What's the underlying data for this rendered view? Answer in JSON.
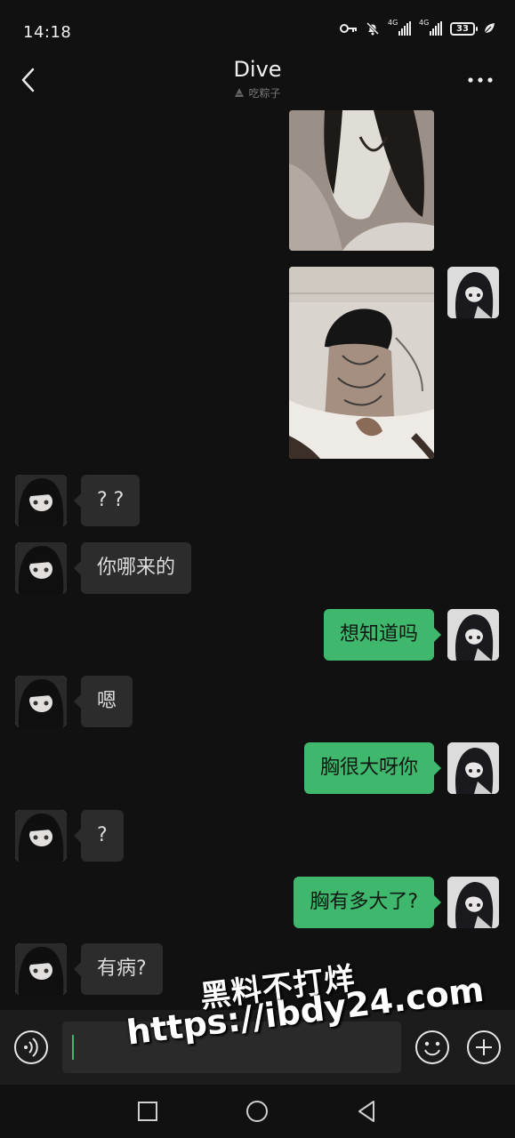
{
  "status_bar": {
    "time": "14:18",
    "network_label_1": "4G",
    "network_label_2": "4G",
    "battery": "33",
    "icons": [
      "key-icon",
      "bell-off-icon",
      "signal-icon",
      "signal-icon",
      "battery-icon",
      "leaf-icon"
    ]
  },
  "header": {
    "title": "Dive",
    "subtitle": "吃粽子",
    "back_icon": "chevron-left-icon",
    "more_icon": "more-horizontal-icon"
  },
  "messages": [
    {
      "side": "right",
      "type": "image",
      "icon": "photo-icon"
    },
    {
      "side": "right",
      "type": "image",
      "icon": "photo-icon"
    },
    {
      "side": "left",
      "type": "text",
      "text": "? ?"
    },
    {
      "side": "left",
      "type": "text",
      "text": "你哪来的"
    },
    {
      "side": "right",
      "type": "text",
      "text": "想知道吗"
    },
    {
      "side": "left",
      "type": "text",
      "text": "嗯"
    },
    {
      "side": "right",
      "type": "text",
      "text": "胸很大呀你"
    },
    {
      "side": "left",
      "type": "text",
      "text": "?"
    },
    {
      "side": "right",
      "type": "text",
      "text": "胸有多大了?"
    },
    {
      "side": "left",
      "type": "text",
      "text": "有病?"
    }
  ],
  "input_bar": {
    "voice_icon": "voice-icon",
    "emoji_icon": "emoji-icon",
    "plus_icon": "plus-icon",
    "text": ""
  },
  "nav_bar": {
    "icons": [
      "recent-apps-icon",
      "home-icon",
      "back-triangle-icon"
    ]
  },
  "watermark": {
    "line1": "黑料不打烊",
    "line2": "https://ibdy24.com"
  },
  "colors": {
    "background": "#111111",
    "bubble_out": "#3fb76d",
    "bubble_in": "#2c2c2c",
    "input_bar": "#1c1c1c"
  }
}
